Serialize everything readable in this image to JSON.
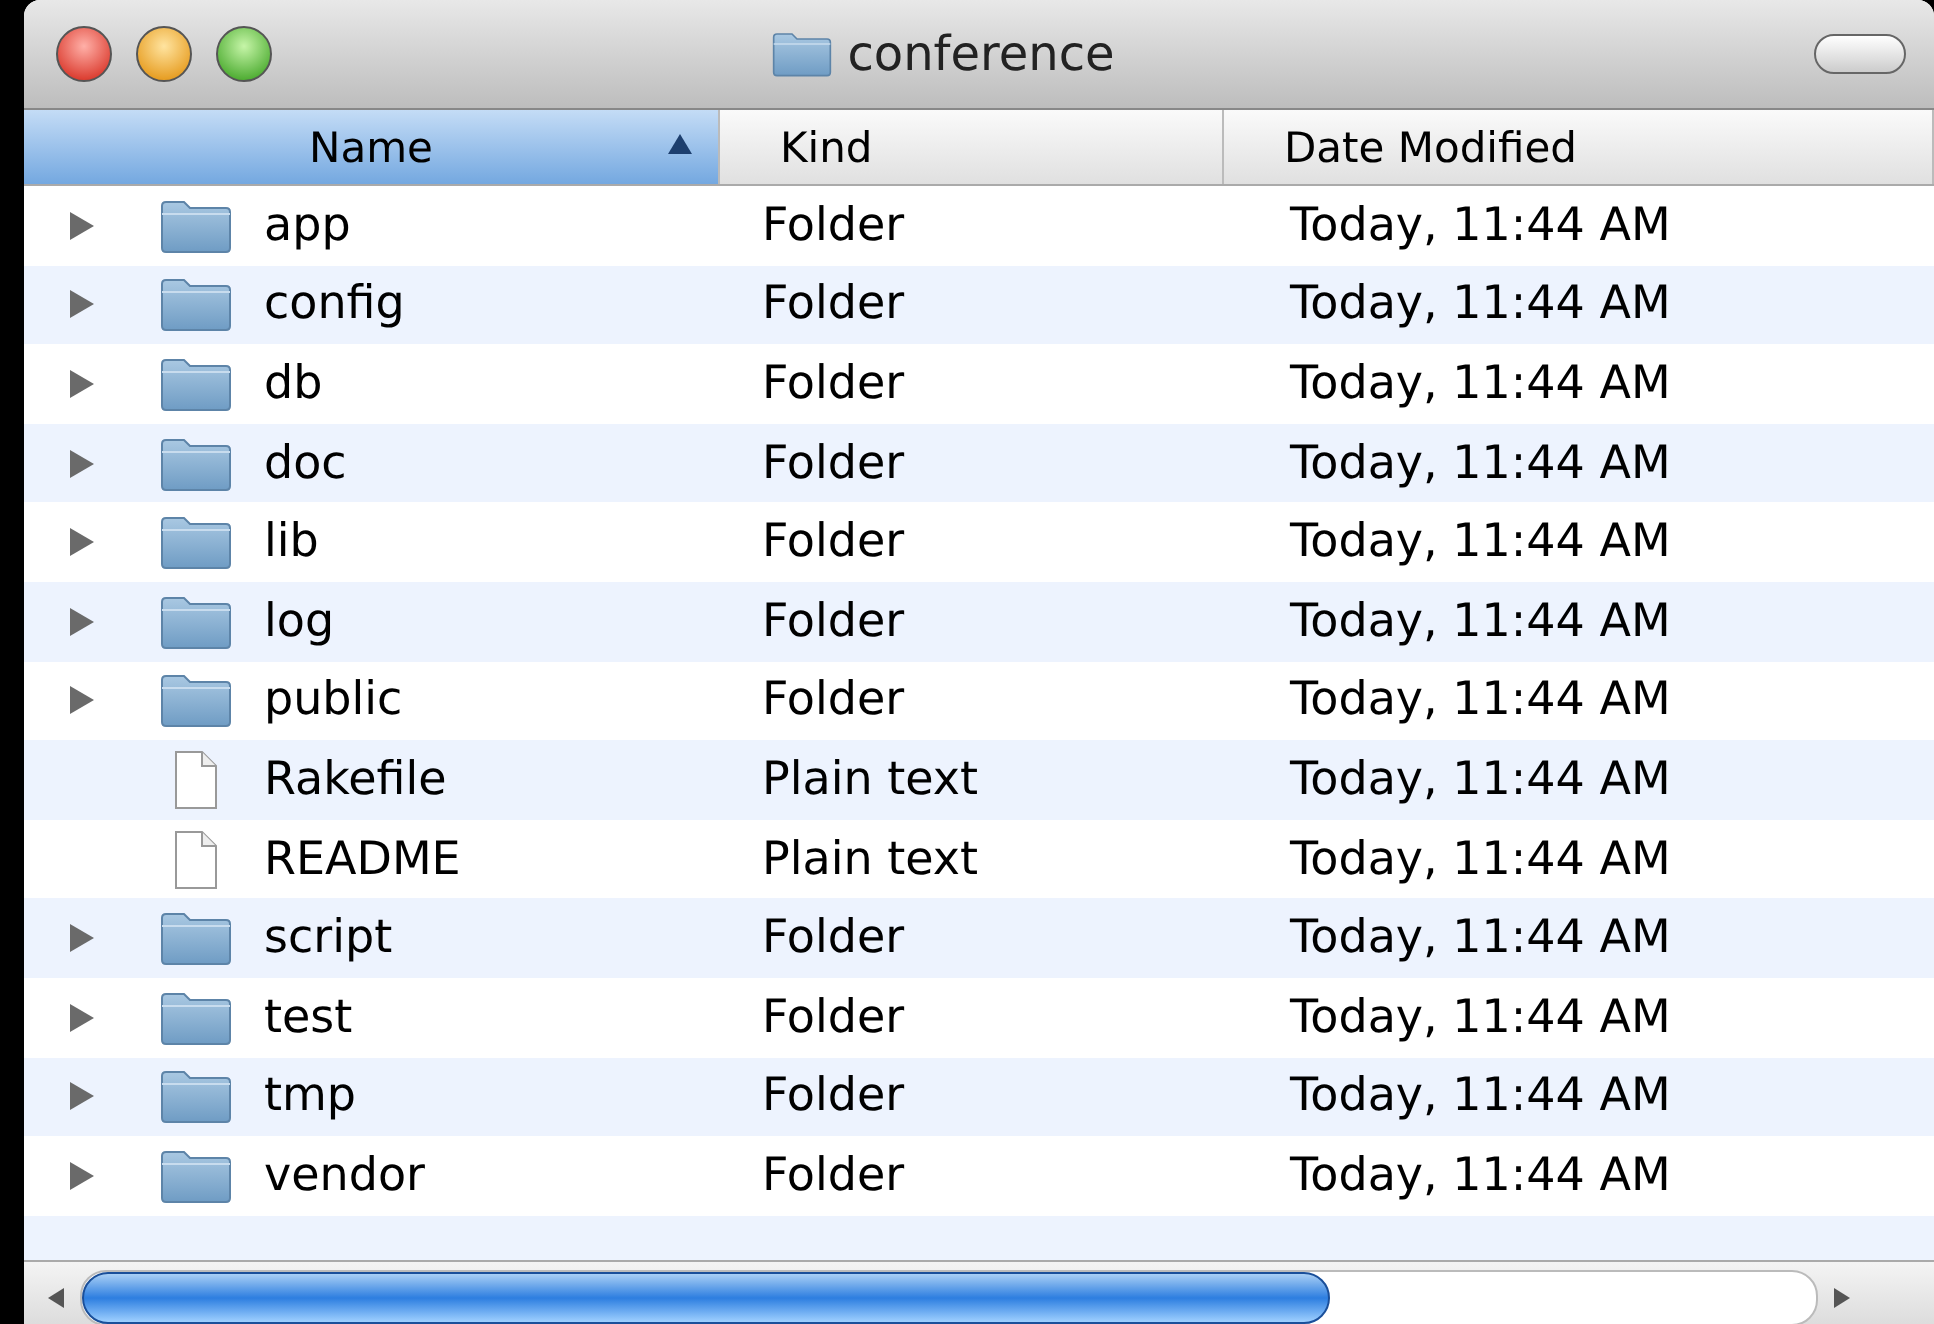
{
  "window": {
    "title": "conference"
  },
  "columns": [
    {
      "label": "Name",
      "selected": true,
      "sorted": true
    },
    {
      "label": "Kind",
      "selected": false,
      "sorted": false
    },
    {
      "label": "Date Modified",
      "selected": false,
      "sorted": false
    }
  ],
  "rows": [
    {
      "kind": "folder",
      "name": "app",
      "type": "Folder",
      "modified": "Today, 11:44 AM"
    },
    {
      "kind": "folder",
      "name": "config",
      "type": "Folder",
      "modified": "Today, 11:44 AM"
    },
    {
      "kind": "folder",
      "name": "db",
      "type": "Folder",
      "modified": "Today, 11:44 AM"
    },
    {
      "kind": "folder",
      "name": "doc",
      "type": "Folder",
      "modified": "Today, 11:44 AM"
    },
    {
      "kind": "folder",
      "name": "lib",
      "type": "Folder",
      "modified": "Today, 11:44 AM"
    },
    {
      "kind": "folder",
      "name": "log",
      "type": "Folder",
      "modified": "Today, 11:44 AM"
    },
    {
      "kind": "folder",
      "name": "public",
      "type": "Folder",
      "modified": "Today, 11:44 AM"
    },
    {
      "kind": "file",
      "name": "Rakefile",
      "type": "Plain text",
      "modified": "Today, 11:44 AM"
    },
    {
      "kind": "file",
      "name": "README",
      "type": "Plain text",
      "modified": "Today, 11:44 AM"
    },
    {
      "kind": "folder",
      "name": "script",
      "type": "Folder",
      "modified": "Today, 11:44 AM"
    },
    {
      "kind": "folder",
      "name": "test",
      "type": "Folder",
      "modified": "Today, 11:44 AM"
    },
    {
      "kind": "folder",
      "name": "tmp",
      "type": "Folder",
      "modified": "Today, 11:44 AM"
    },
    {
      "kind": "folder",
      "name": "vendor",
      "type": "Folder",
      "modified": "Today, 11:44 AM"
    }
  ]
}
